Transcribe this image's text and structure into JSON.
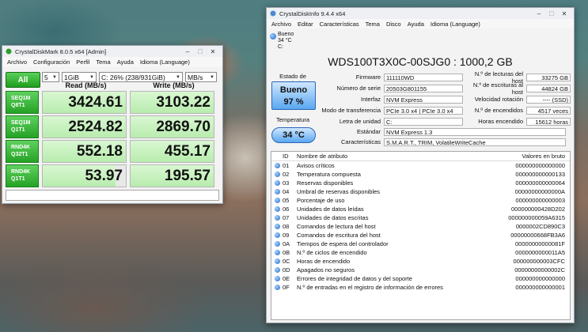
{
  "cdm": {
    "title": "CrystalDiskMark 8.0.5 x64 [Admin]",
    "menu": [
      "Archivo",
      "Configuración",
      "Perfil",
      "Tema",
      "Ayuda",
      "Idioma (Language)"
    ],
    "all_label": "All",
    "count": "5",
    "size": "1GiB",
    "drive": "C: 26% (238/931GiB)",
    "unit": "MB/s",
    "col_read": "Read (MB/s)",
    "col_write": "Write (MB/s)",
    "rows": [
      {
        "l1": "SEQ1M",
        "l2": "Q8T1",
        "read": "3424.61",
        "write": "3103.22",
        "read_frac": 1.0,
        "write_frac": 1.0
      },
      {
        "l1": "SEQ1M",
        "l2": "Q1T1",
        "read": "2524.82",
        "write": "2869.70",
        "read_frac": 1.0,
        "write_frac": 1.0
      },
      {
        "l1": "RND4K",
        "l2": "Q32T1",
        "read": "552.18",
        "write": "455.17",
        "read_frac": 1.0,
        "write_frac": 1.0
      },
      {
        "l1": "RND4K",
        "l2": "Q1T1",
        "read": "53.97",
        "write": "195.57",
        "read_frac": 0.88,
        "write_frac": 1.0
      }
    ]
  },
  "cdi": {
    "title": "CrystalDiskInfo 9.4.4 x64",
    "menu": [
      "Archivo",
      "Editar",
      "Características",
      "Tema",
      "Disco",
      "Ayuda",
      "Idioma (Language)"
    ],
    "drive_tab": {
      "status": "Bueno",
      "temp": "34 °C",
      "letter": "C:"
    },
    "drive_title": "WDS100T3X0C-00SJG0 : 1000,2 GB",
    "health_label": "Estado de salud",
    "health_status": "Bueno",
    "health_percent": "97 %",
    "temp_label": "Temperatura",
    "temp_value": "34 °C",
    "info_left": [
      {
        "key": "Firmware",
        "value": "111110WD"
      },
      {
        "key": "Número de serie",
        "value": "20503G801155"
      },
      {
        "key": "Interfaz",
        "value": "NVM Express"
      },
      {
        "key": "Modo de transferencia",
        "value": "PCIe 3.0 x4 | PCIe 3.0 x4"
      },
      {
        "key": "Letra de unidad",
        "value": "C:"
      }
    ],
    "info_right": [
      {
        "key": "N.º de lecturas del host",
        "value": "33275 GB"
      },
      {
        "key": "N.º de escrituras al host",
        "value": "44824 GB"
      },
      {
        "key": "Velocidad rotación",
        "value": "---- (SSD)"
      },
      {
        "key": "N.º de encendidos",
        "value": "4517 veces"
      },
      {
        "key": "Horas encendido",
        "value": "15612 horas"
      }
    ],
    "standard": {
      "key": "Estándar",
      "value": "NVM Express 1.3"
    },
    "features": {
      "key": "Características",
      "value": "S.M.A.R.T., TRIM, VolatileWriteCache"
    },
    "table_headers": {
      "id": "ID",
      "name": "Nombre de atributo",
      "raw": "Valores en bruto"
    },
    "attributes": [
      {
        "id": "01",
        "name": "Avisos críticos",
        "raw": "000000000000000"
      },
      {
        "id": "02",
        "name": "Temperatura compuesta",
        "raw": "000000000000133"
      },
      {
        "id": "03",
        "name": "Reservas disponibles",
        "raw": "000000000000064"
      },
      {
        "id": "04",
        "name": "Umbral de reservas disponibles",
        "raw": "00000000000000A"
      },
      {
        "id": "05",
        "name": "Porcentaje de uso",
        "raw": "000000000000003"
      },
      {
        "id": "06",
        "name": "Unidades de datos leídas",
        "raw": "000000000428D202"
      },
      {
        "id": "07",
        "name": "Unidades de datos escritas",
        "raw": "000000000059A6315"
      },
      {
        "id": "08",
        "name": "Comandos de lectura del host",
        "raw": "0000002CD890C3"
      },
      {
        "id": "09",
        "name": "Comandos de escritura del host",
        "raw": "00000000668FB3A6"
      },
      {
        "id": "0A",
        "name": "Tiempos de espera del controlador",
        "raw": "00000000000081F"
      },
      {
        "id": "0B",
        "name": "N.º de ciclos de encendido",
        "raw": "0000000000011A5"
      },
      {
        "id": "0C",
        "name": "Horas de encendido",
        "raw": "000000000003CFC"
      },
      {
        "id": "0D",
        "name": "Apagados no seguros",
        "raw": "00000000000002C"
      },
      {
        "id": "0E",
        "name": "Errores de integridad de datos y del soporte",
        "raw": "000000000000000"
      },
      {
        "id": "0F",
        "name": "N.º de entradas en el registro de información de errores",
        "raw": "000000000000001"
      }
    ]
  }
}
